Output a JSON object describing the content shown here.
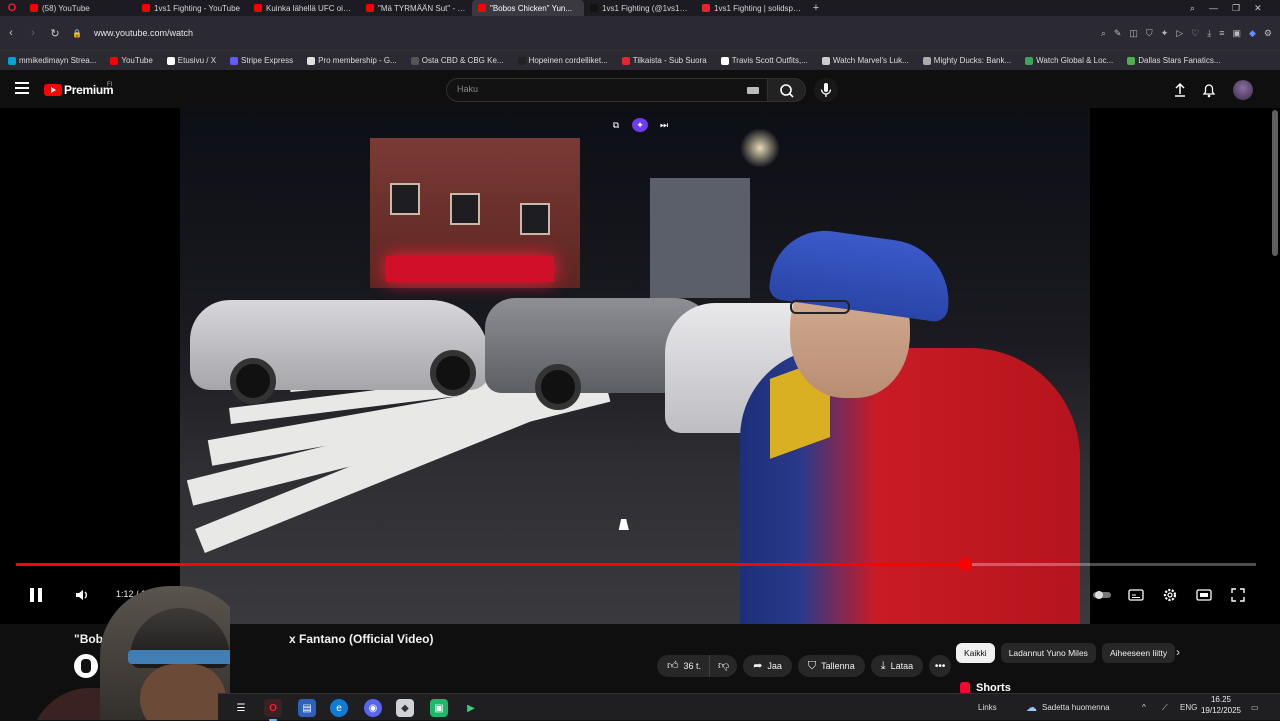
{
  "browser": {
    "tabs": [
      {
        "label": "(58) YouTube",
        "fav": "#ff0000",
        "active": false
      },
      {
        "label": "1vs1 Fighting - YouTube",
        "fav": "#ff0000",
        "active": false
      },
      {
        "label": "Kuinka lähellä UFC oikeasti...",
        "fav": "#ff0000",
        "active": false
      },
      {
        "label": "\"Mä TYRMÄÄN Sut\" - Cla...",
        "fav": "#ff0000",
        "active": false
      },
      {
        "label": "\"Bobos Chicken\" Yun...",
        "fav": "#ff0000",
        "active": true
      },
      {
        "label": "1vs1 Fighting (@1vs1_figh...",
        "fav": "#111111",
        "active": false
      },
      {
        "label": "1vs1 Fighting | solidsport...",
        "fav": "#e3262f",
        "active": false
      }
    ],
    "new_tab": "+",
    "url": "www.youtube.com/watch",
    "bookmarks": [
      {
        "label": "mmikedimayn Strea...",
        "color": "#00a1d6"
      },
      {
        "label": "YouTube",
        "color": "#ff0000"
      },
      {
        "label": "Etusivu / X",
        "color": "#ffffff"
      },
      {
        "label": "Stripe Express",
        "color": "#635bff"
      },
      {
        "label": "Pro membership - G...",
        "color": "#e0e0e0"
      },
      {
        "label": "Osta CBD & CBG Ke...",
        "color": "#555555"
      },
      {
        "label": "Hopeinen cordelliket...",
        "color": "#222222"
      },
      {
        "label": "Tilkaista - Sub Suora",
        "color": "#e3262f"
      },
      {
        "label": "Travis Scott Outfits,...",
        "color": "#ffffff"
      },
      {
        "label": "Watch Marvel's Luk...",
        "color": "#cccccc"
      },
      {
        "label": "Mighty Ducks: Bank...",
        "color": "#aaaaaa"
      },
      {
        "label": "Watch Global & Loc...",
        "color": "#3ba55c"
      },
      {
        "label": "Dallas Stars Fanatics...",
        "color": "#4caf50"
      }
    ]
  },
  "youtube": {
    "logo_text": "Premium",
    "country_code": "FI",
    "search_placeholder": "Haku",
    "player": {
      "time_display": "1:12 / 1",
      "progress_fraction": 0.765
    },
    "video_title_start": "\"Bobos C",
    "video_title_end": "x Fantano (Official Video)",
    "channel_name_partial": "Y",
    "actions": {
      "like_count": "36 t.",
      "share": "Jaa",
      "save": "Tallenna",
      "download": "Lataa"
    },
    "chips": [
      "Kaikki",
      "Ladannut Yuno Miles",
      "Aiheeseen liitty"
    ],
    "shorts_label": "Shorts"
  },
  "taskbar": {
    "links_label": "Links",
    "weather": "Sadetta huomenna",
    "language": "ENG",
    "time": "16.25",
    "date": "19/12/2025"
  },
  "colors": {
    "accent": "#ff0000",
    "background": "#0f0f0f"
  }
}
